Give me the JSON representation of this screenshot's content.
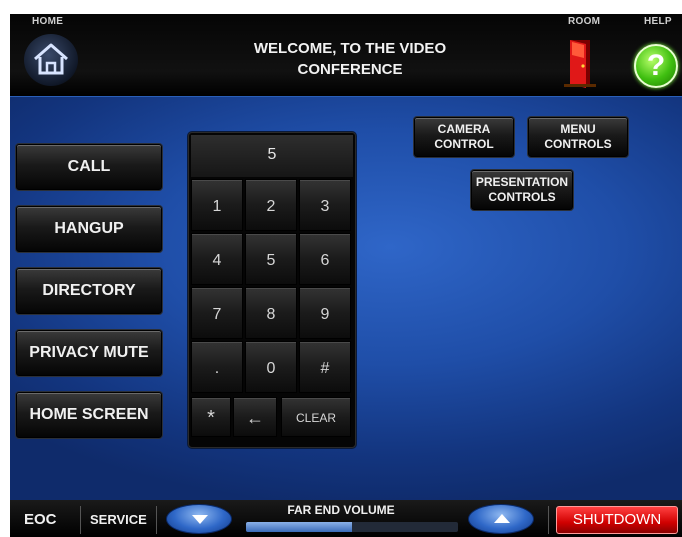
{
  "header": {
    "home_label": "HOME",
    "room_label": "ROOM",
    "help_label": "HELP",
    "title_line1": "WELCOME, TO THE VIDEO",
    "title_line2": "CONFERENCE",
    "help_glyph": "?",
    "icons": [
      "home-icon",
      "door-exit-icon",
      "help-icon"
    ]
  },
  "left_buttons": [
    "CALL",
    "HANGUP",
    "DIRECTORY",
    "PRIVACY MUTE",
    "HOME SCREEN"
  ],
  "keypad": {
    "display_value": "5",
    "keys": [
      "1",
      "2",
      "3",
      "4",
      "5",
      "6",
      "7",
      "8",
      "9",
      ".",
      "0",
      "#"
    ],
    "star": "*",
    "backspace": "←",
    "clear": "CLEAR"
  },
  "controls": {
    "camera_line1": "CAMERA",
    "camera_line2": "CONTROL",
    "menu_line1": "MENU",
    "menu_line2": "CONTROLS",
    "presentation_line1": "PRESENTATION",
    "presentation_line2": "CONTROLS"
  },
  "footer": {
    "eoc": "EOC",
    "service": "SERVICE",
    "volume_label": "FAR END VOLUME",
    "volume_level": 0.5,
    "shutdown": "SHUTDOWN"
  },
  "colors": {
    "background_blue": "#1f4ea8",
    "shutdown_red": "#d00000",
    "help_green": "#3fbf10"
  }
}
